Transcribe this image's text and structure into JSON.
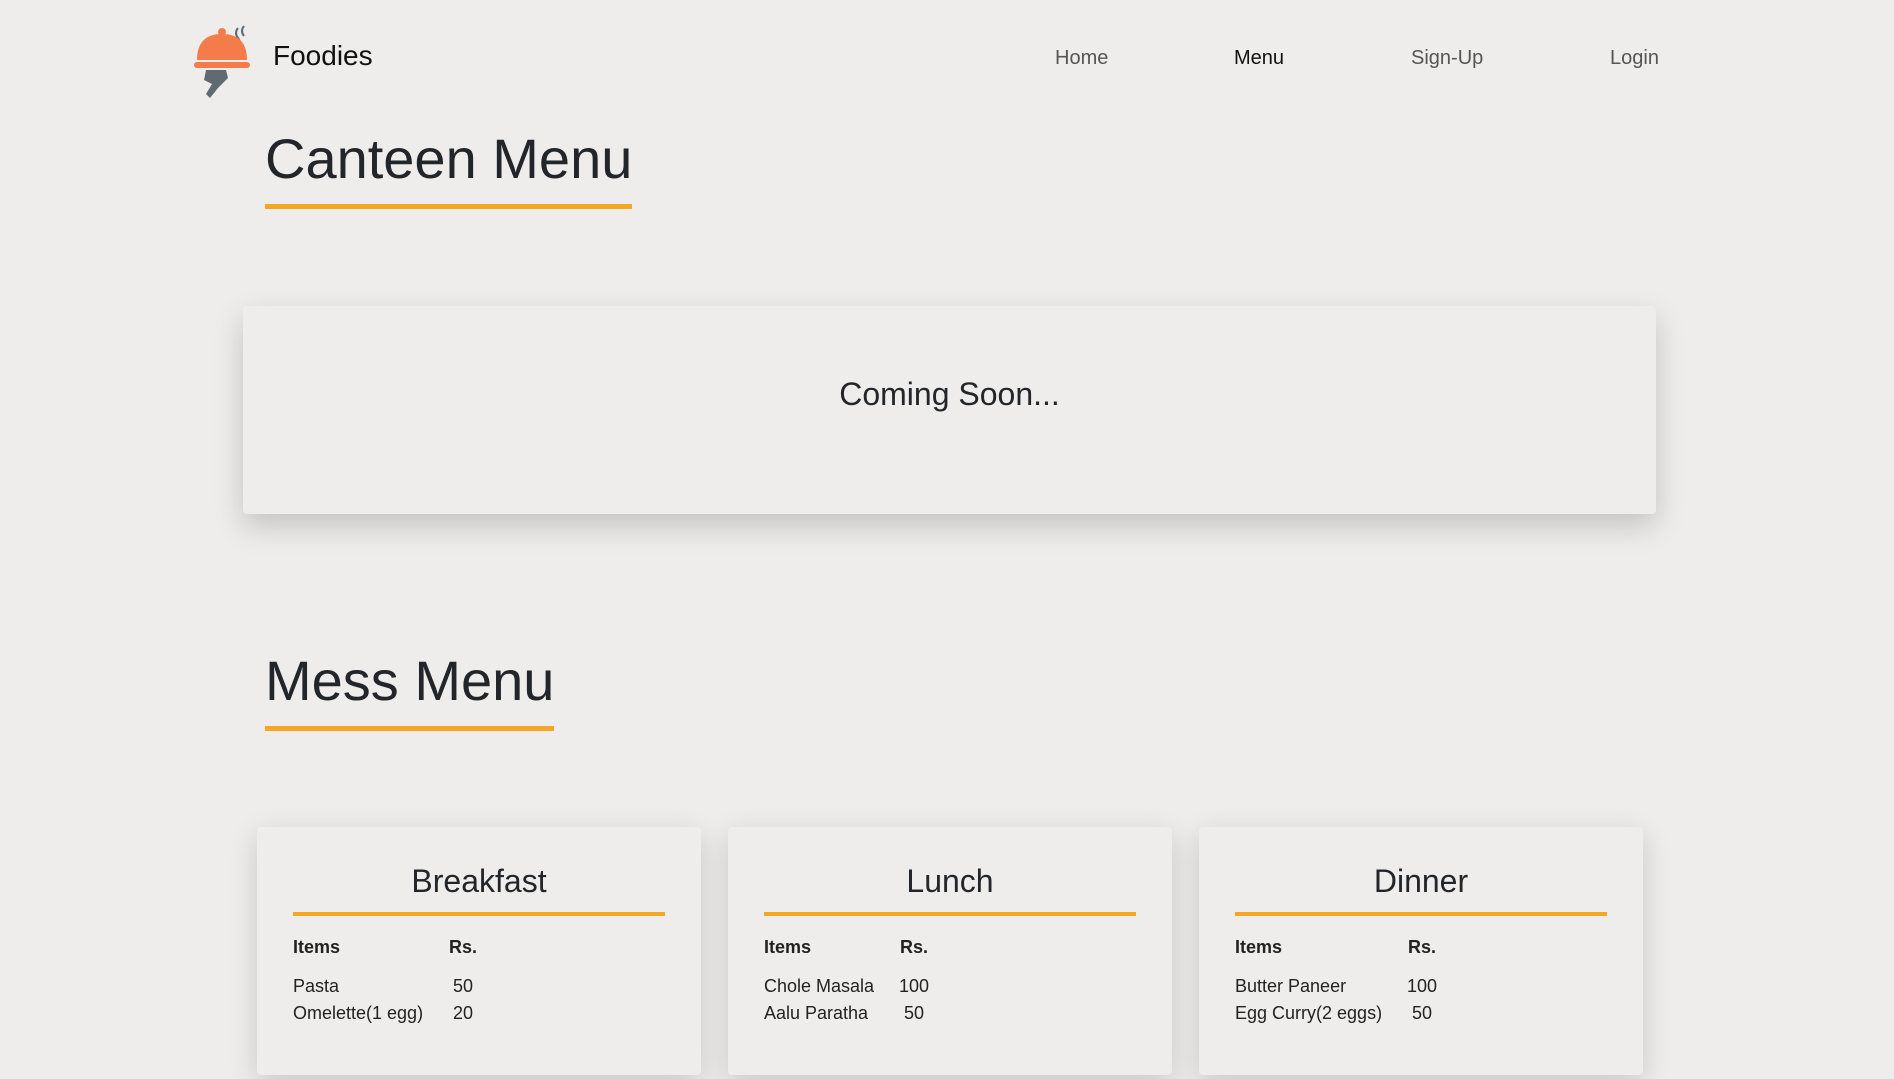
{
  "header": {
    "brand": "Foodies",
    "nav": [
      {
        "label": "Home",
        "active": false
      },
      {
        "label": "Menu",
        "active": true
      },
      {
        "label": "Sign-Up",
        "active": false
      },
      {
        "label": "Login",
        "active": false
      }
    ]
  },
  "canteen": {
    "title": "Canteen Menu",
    "status": "Coming Soon..."
  },
  "mess": {
    "title": "Mess Menu",
    "meals": [
      {
        "name": "Breakfast",
        "columns": [
          "Items",
          "Rs."
        ],
        "rows": [
          {
            "item": "Pasta",
            "price": "50"
          },
          {
            "item": "Omelette(1 egg)",
            "price": "20"
          }
        ]
      },
      {
        "name": "Lunch",
        "columns": [
          "Items",
          "Rs."
        ],
        "rows": [
          {
            "item": "Chole Masala",
            "price": "100"
          },
          {
            "item": "Aalu Paratha",
            "price": "50"
          }
        ]
      },
      {
        "name": "Dinner",
        "columns": [
          "Items",
          "Rs."
        ],
        "rows": [
          {
            "item": "Butter Paneer",
            "price": "100"
          },
          {
            "item": "Egg Curry(2 eggs)",
            "price": "50"
          }
        ]
      }
    ]
  },
  "colors": {
    "accent": "#f5a623",
    "background": "#efedeb",
    "logo_primary": "#f47c4a",
    "logo_secondary": "#5f6b73"
  }
}
